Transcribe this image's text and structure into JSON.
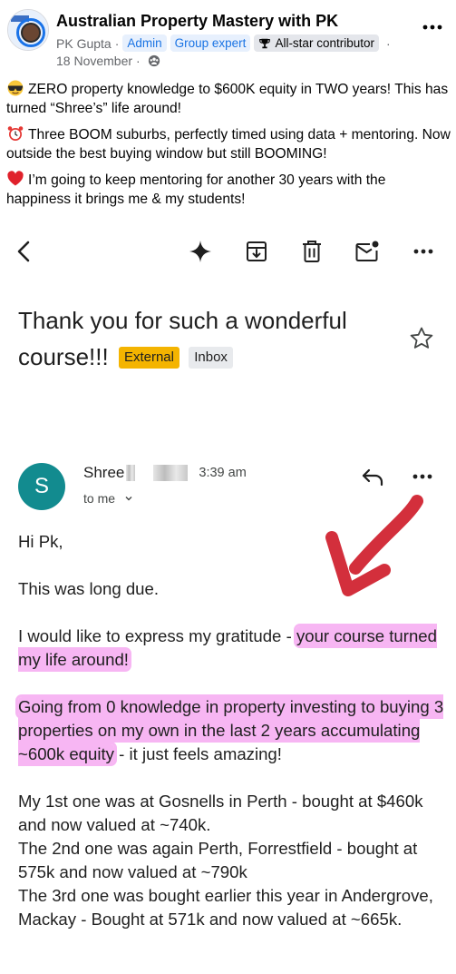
{
  "post": {
    "group_name": "Australian Property Mastery with PK",
    "author": "PK Gupta",
    "separator": "·",
    "badges": [
      "Admin",
      "Group expert"
    ],
    "contributor_badge": "All-star contributor",
    "date": "18 November",
    "paragraphs": [
      {
        "emoji": "sunglasses",
        "text": "ZERO property knowledge to $600K equity in TWO years! This has turned “Shree’s” life around!"
      },
      {
        "emoji": "alarm-clock",
        "text": "Three BOOM suburbs, perfectly timed using data + mentoring. Now outside the best buying window but still BOOMING!"
      },
      {
        "emoji": "red-heart",
        "text": "I’m going to keep mentoring for another 30 years with the happiness it brings me & my students!"
      }
    ]
  },
  "email": {
    "subject": "Thank you for such a wonderful course!!!",
    "labels": [
      "External",
      "Inbox"
    ],
    "sender_initial": "S",
    "sender_name": "Shree",
    "time": "3:39 am",
    "recipient": "to me",
    "greeting": "Hi Pk,",
    "line1": "This was long due.",
    "gratitude_prefix": "I would like to express my gratitude - ",
    "gratitude_highlight": "your course turned my life around!",
    "journey_highlight": "Going from 0 knowledge in property investing to buying 3 properties on my own in the last 2 years accumulating ~600k equity",
    "journey_suffix": " - it just feels amazing!",
    "properties": [
      "My 1st one was at Gosnells in Perth - bought at $460k and now valued at ~740k.",
      "The 2nd one was again Perth, Forrestfield - bought at 575k and now valued at ~790k",
      "The 3rd one was bought earlier this year in Andergrove, Mackay - Bought at 571k and now valued at ~665k."
    ]
  },
  "colors": {
    "highlight": "#f7b6f3",
    "avatar": "#128b8f",
    "external_label": "#f4b400",
    "annotation_arrow": "#d32f3c",
    "fb_badge_text": "#1b74e4"
  },
  "icons": {
    "toolbar": [
      "back-arrow-icon",
      "gemini-sparkle-icon",
      "archive-icon",
      "delete-icon",
      "mark-unread-icon",
      "more-icon"
    ],
    "message": [
      "reply-icon",
      "more-icon"
    ]
  }
}
